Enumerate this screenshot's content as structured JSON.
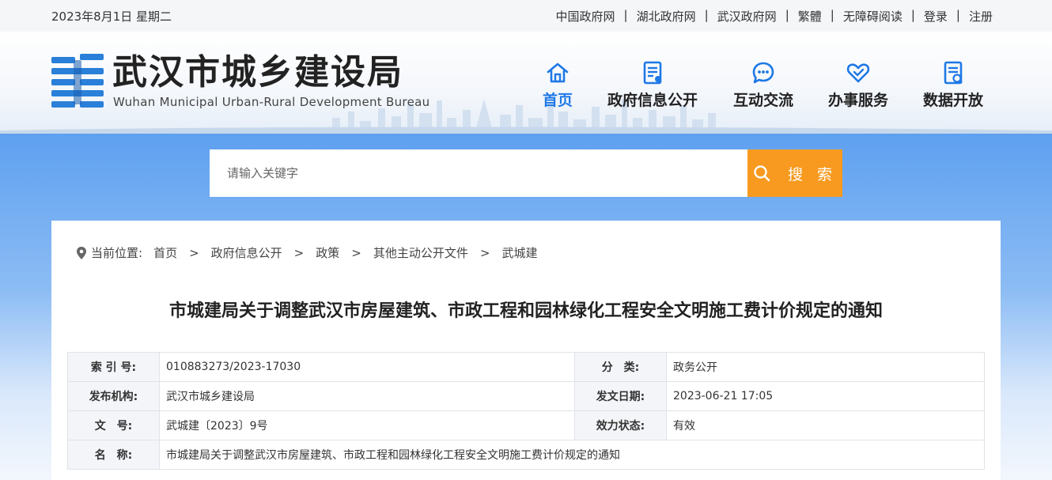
{
  "topbar": {
    "date": "2023年8月1日 星期二",
    "links": [
      "中国政府网",
      "湖北政府网",
      "武汉政府网",
      "繁體",
      "无障碍阅读",
      "登录",
      "注册"
    ]
  },
  "header": {
    "title": "武汉市城乡建设局",
    "subtitle": "Wuhan Municipal Urban-Rural Development Bureau",
    "nav": [
      {
        "label": "首页",
        "icon": "home-icon",
        "active": true
      },
      {
        "label": "政府信息公开",
        "icon": "document-icon",
        "active": false
      },
      {
        "label": "互动交流",
        "icon": "chat-icon",
        "active": false
      },
      {
        "label": "办事服务",
        "icon": "service-heart-icon",
        "active": false
      },
      {
        "label": "数据开放",
        "icon": "data-document-icon",
        "active": false
      }
    ]
  },
  "search": {
    "placeholder": "请输入关键字",
    "button_label": "搜 索"
  },
  "breadcrumb": {
    "prefix": "当前位置:",
    "items": [
      "首页",
      "政府信息公开",
      "政策",
      "其他主动公开文件",
      "武城建"
    ],
    "separator": ">"
  },
  "document": {
    "title": "市城建局关于调整武汉市房屋建筑、市政工程和园林绿化工程安全文明施工费计价规定的通知",
    "meta": {
      "index_label": "索 引 号:",
      "index_value": "010883273/2023-17030",
      "category_label": "分　类:",
      "category_value": "政务公开",
      "publisher_label": "发布机构:",
      "publisher_value": "武汉市城乡建设局",
      "date_label": "发文日期:",
      "date_value": "2023-06-21 17:05",
      "docno_label": "文　号:",
      "docno_value": "武城建〔2023〕9号",
      "status_label": "效力状态:",
      "status_value": "有效",
      "name_label": "名　称:",
      "name_value": "市城建局关于调整武汉市房屋建筑、市政工程和园林绿化工程安全文明施工费计价规定的通知"
    }
  },
  "colors": {
    "accent": "#1e78e6",
    "search_button": "#f79a1f",
    "band_top": "#5ea0f0"
  }
}
